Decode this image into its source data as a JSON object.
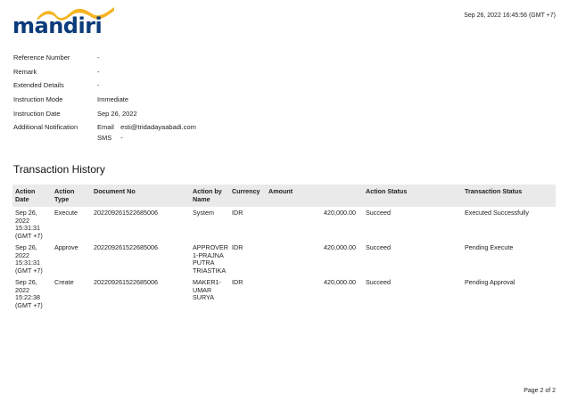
{
  "header": {
    "logo_text": "mandiri",
    "timestamp": "Sep 26, 2022 16:45:56 (GMT +7)"
  },
  "details": [
    {
      "label": "Reference Number",
      "value": "-"
    },
    {
      "label": "Remark",
      "value": "-"
    },
    {
      "label": "Extended Details",
      "value": "-"
    },
    {
      "label": "Instruction Mode",
      "value": "Immediate"
    },
    {
      "label": "Instruction Date",
      "value": "Sep 26, 2022"
    }
  ],
  "notification": {
    "label": "Additional Notification",
    "email_label": "Email",
    "email_value": "esti@tridadayaabadi.com",
    "sms_label": "SMS",
    "sms_value": "-"
  },
  "history": {
    "title": "Transaction History",
    "columns": [
      {
        "label": "Action Date"
      },
      {
        "label": "Action Type"
      },
      {
        "label": "Document No"
      },
      {
        "label": "Action by Name"
      },
      {
        "label": "Currency"
      },
      {
        "label": "Amount"
      },
      {
        "label": "Action Status"
      },
      {
        "label": "Transaction Status"
      }
    ],
    "rows": [
      {
        "date": "Sep 26, 2022 15:31:31 (GMT +7)",
        "type": "Execute",
        "doc": "202209261522685006",
        "by": "System",
        "currency": "IDR",
        "amount": "420,000.00",
        "action_status": "Succeed",
        "tx_status": "Executed Successfully"
      },
      {
        "date": "Sep 26, 2022 15:31:31 (GMT +7)",
        "type": "Approve",
        "doc": "202209261522685006",
        "by": "APPROVER 1-PRAJNA PUTRA TRIASTIKA",
        "currency": "IDR",
        "amount": "420,000.00",
        "action_status": "Succeed",
        "tx_status": "Pending Execute"
      },
      {
        "date": "Sep 26, 2022 15:22:38 (GMT +7)",
        "type": "Create",
        "doc": "202209261522685006",
        "by": "MAKER1-UMAR SURYA",
        "currency": "IDR",
        "amount": "420,000.00",
        "action_status": "Succeed",
        "tx_status": "Pending Approval"
      }
    ]
  },
  "footer": {
    "page": "Page 2 of 2"
  },
  "colors": {
    "brand_blue": "#0b3b7a",
    "brand_yellow": "#f5b320",
    "header_bg": "#eaeaea"
  }
}
